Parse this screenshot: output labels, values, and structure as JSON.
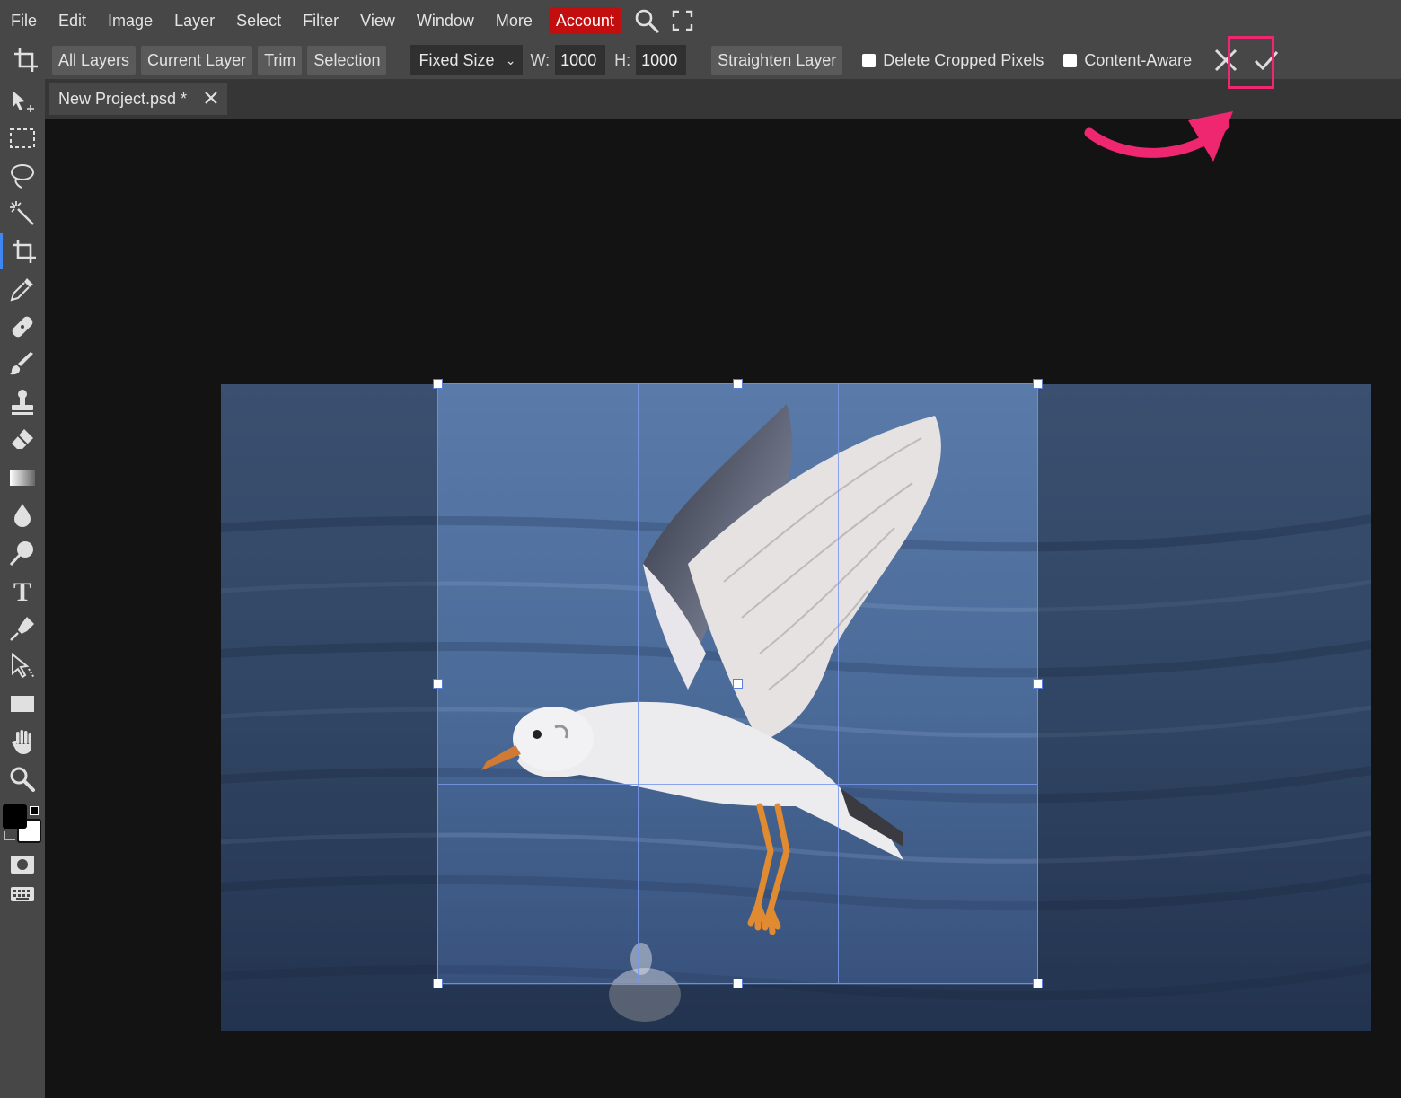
{
  "menu": {
    "items": [
      "File",
      "Edit",
      "Image",
      "Layer",
      "Select",
      "Filter",
      "View",
      "Window",
      "More"
    ],
    "account": "Account"
  },
  "options": {
    "buttons": [
      "All Layers",
      "Current Layer",
      "Trim",
      "Selection"
    ],
    "size_mode": "Fixed Size",
    "width_label": "W:",
    "width_value": "1000",
    "height_label": "H:",
    "height_value": "1000",
    "straighten": "Straighten Layer",
    "delete_cropped": "Delete Cropped Pixels",
    "content_aware": "Content-Aware"
  },
  "tab": {
    "title": "New Project.psd *"
  },
  "tools": [
    "move-tool",
    "marquee-tool",
    "lasso-tool",
    "magic-wand-tool",
    "crop-tool",
    "eyedropper-tool",
    "healing-tool",
    "brush-tool",
    "clone-stamp-tool",
    "eraser-tool",
    "gradient-tool",
    "blur-tool",
    "dodge-tool",
    "text-tool",
    "pen-tool",
    "path-select-tool",
    "shape-tool",
    "hand-tool",
    "zoom-tool"
  ],
  "colors": {
    "foreground": "#000000",
    "background": "#ffffff",
    "accent": "#3f86f3",
    "account": "#c20e0e",
    "highlight": "#ee2770"
  }
}
